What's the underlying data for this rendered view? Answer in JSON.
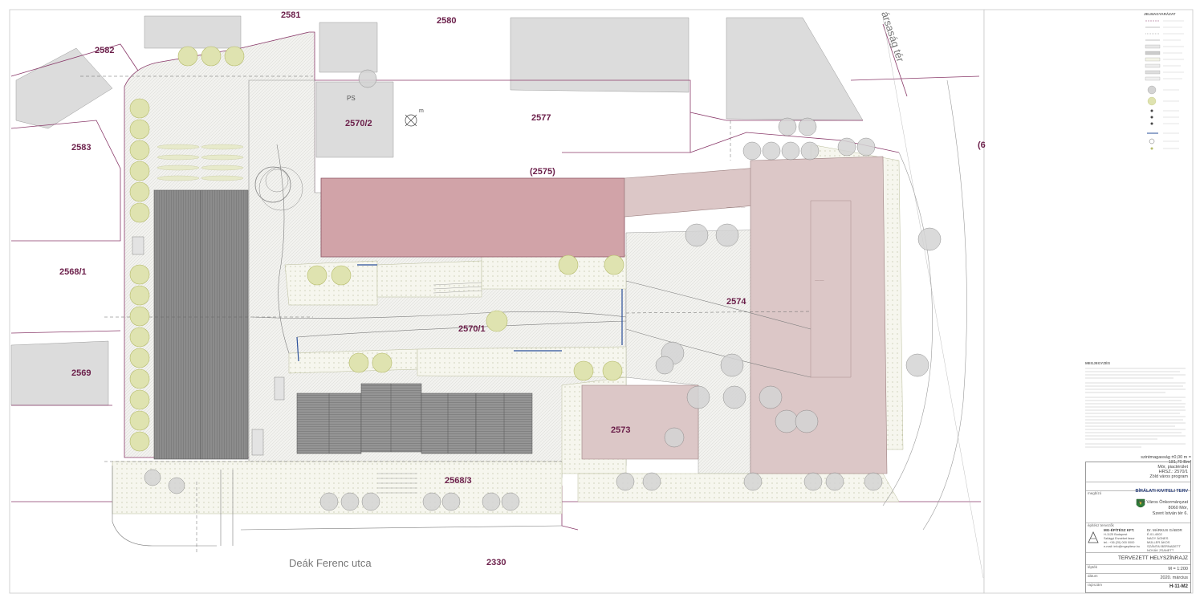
{
  "parcels": {
    "p2581": "2581",
    "p2580": "2580",
    "p2582": "2582",
    "p2583": "2583",
    "p2568_1": "2568/1",
    "p2569": "2569",
    "p2570_2": "2570/2",
    "p2577": "2577",
    "p2575": "(2575)",
    "p2574": "2574",
    "p2570_1": "2570/1",
    "p2573": "2573",
    "p2568_3": "2568/3",
    "p2330": "2330",
    "p6": "(6",
    "ps": "PS"
  },
  "streets": {
    "deak": "Deák Ferenc utca",
    "tarsasag": "ársaság tér"
  },
  "title_block": {
    "note": "szintmagasság ±0,00 m = 181,70 Bmf",
    "project_line1": "Mór, piactérület",
    "project_line2": "HRSZ.: 2570/1",
    "project_line3": "Zöld város program",
    "phase": "BÍRÁLATI KIVITELI TERV",
    "label_megbizo": "megbízó",
    "client_line1": "Mór Város Önkormányzat",
    "client_line2": "8060 Mór,",
    "client_line3": "Szent István tér 6.",
    "label_epitesz": "építész tervezők",
    "firm_name": "MG-ÉPÍTÉSZ KFT.",
    "firm_line1": "H-1125 Budapest",
    "firm_line2": "Szilágyi Erzsébet fasor",
    "firm_line3": "tel.: +36 (20) 000 0000",
    "firm_line4": "e-mail: info@mgepitesz.hu",
    "designer1": "Dr. MÁRKUS GÁBOR",
    "designer2": "É-01-4002",
    "designer3": "NAGY ÁGNES",
    "designer4": "MÜLLER ÁKOS",
    "designer5": "SZÁNTAI BERNADETT",
    "designer6": "NOVÁK ZSANETT",
    "drawing_title": "TERVEZETT HELYSZÍNRAJZ",
    "label_lepték": "lépték",
    "scale": "M = 1:200",
    "label_datum": "dátum",
    "date": "2020. március",
    "label_rajzszam": "rajzszám",
    "sheet_no": "H-11-M2"
  },
  "legend_title": "JELMAGYARÁZAT",
  "notes_title": "MEGJEGYZÉS",
  "colors": {
    "parcel_line": "#8a3a6a",
    "building_red": "#d1a3a8",
    "building_pink": "#dcc7c7",
    "building_grey": "#d6d6d6",
    "paving": "#efefea",
    "green_dots": "#f3f4e8",
    "tree_fill": "#dfe3b0",
    "tree_stroke": "#b5bb6a",
    "canopy_grey": "#c8c8c8",
    "market_grey": "#8a8a8a"
  }
}
